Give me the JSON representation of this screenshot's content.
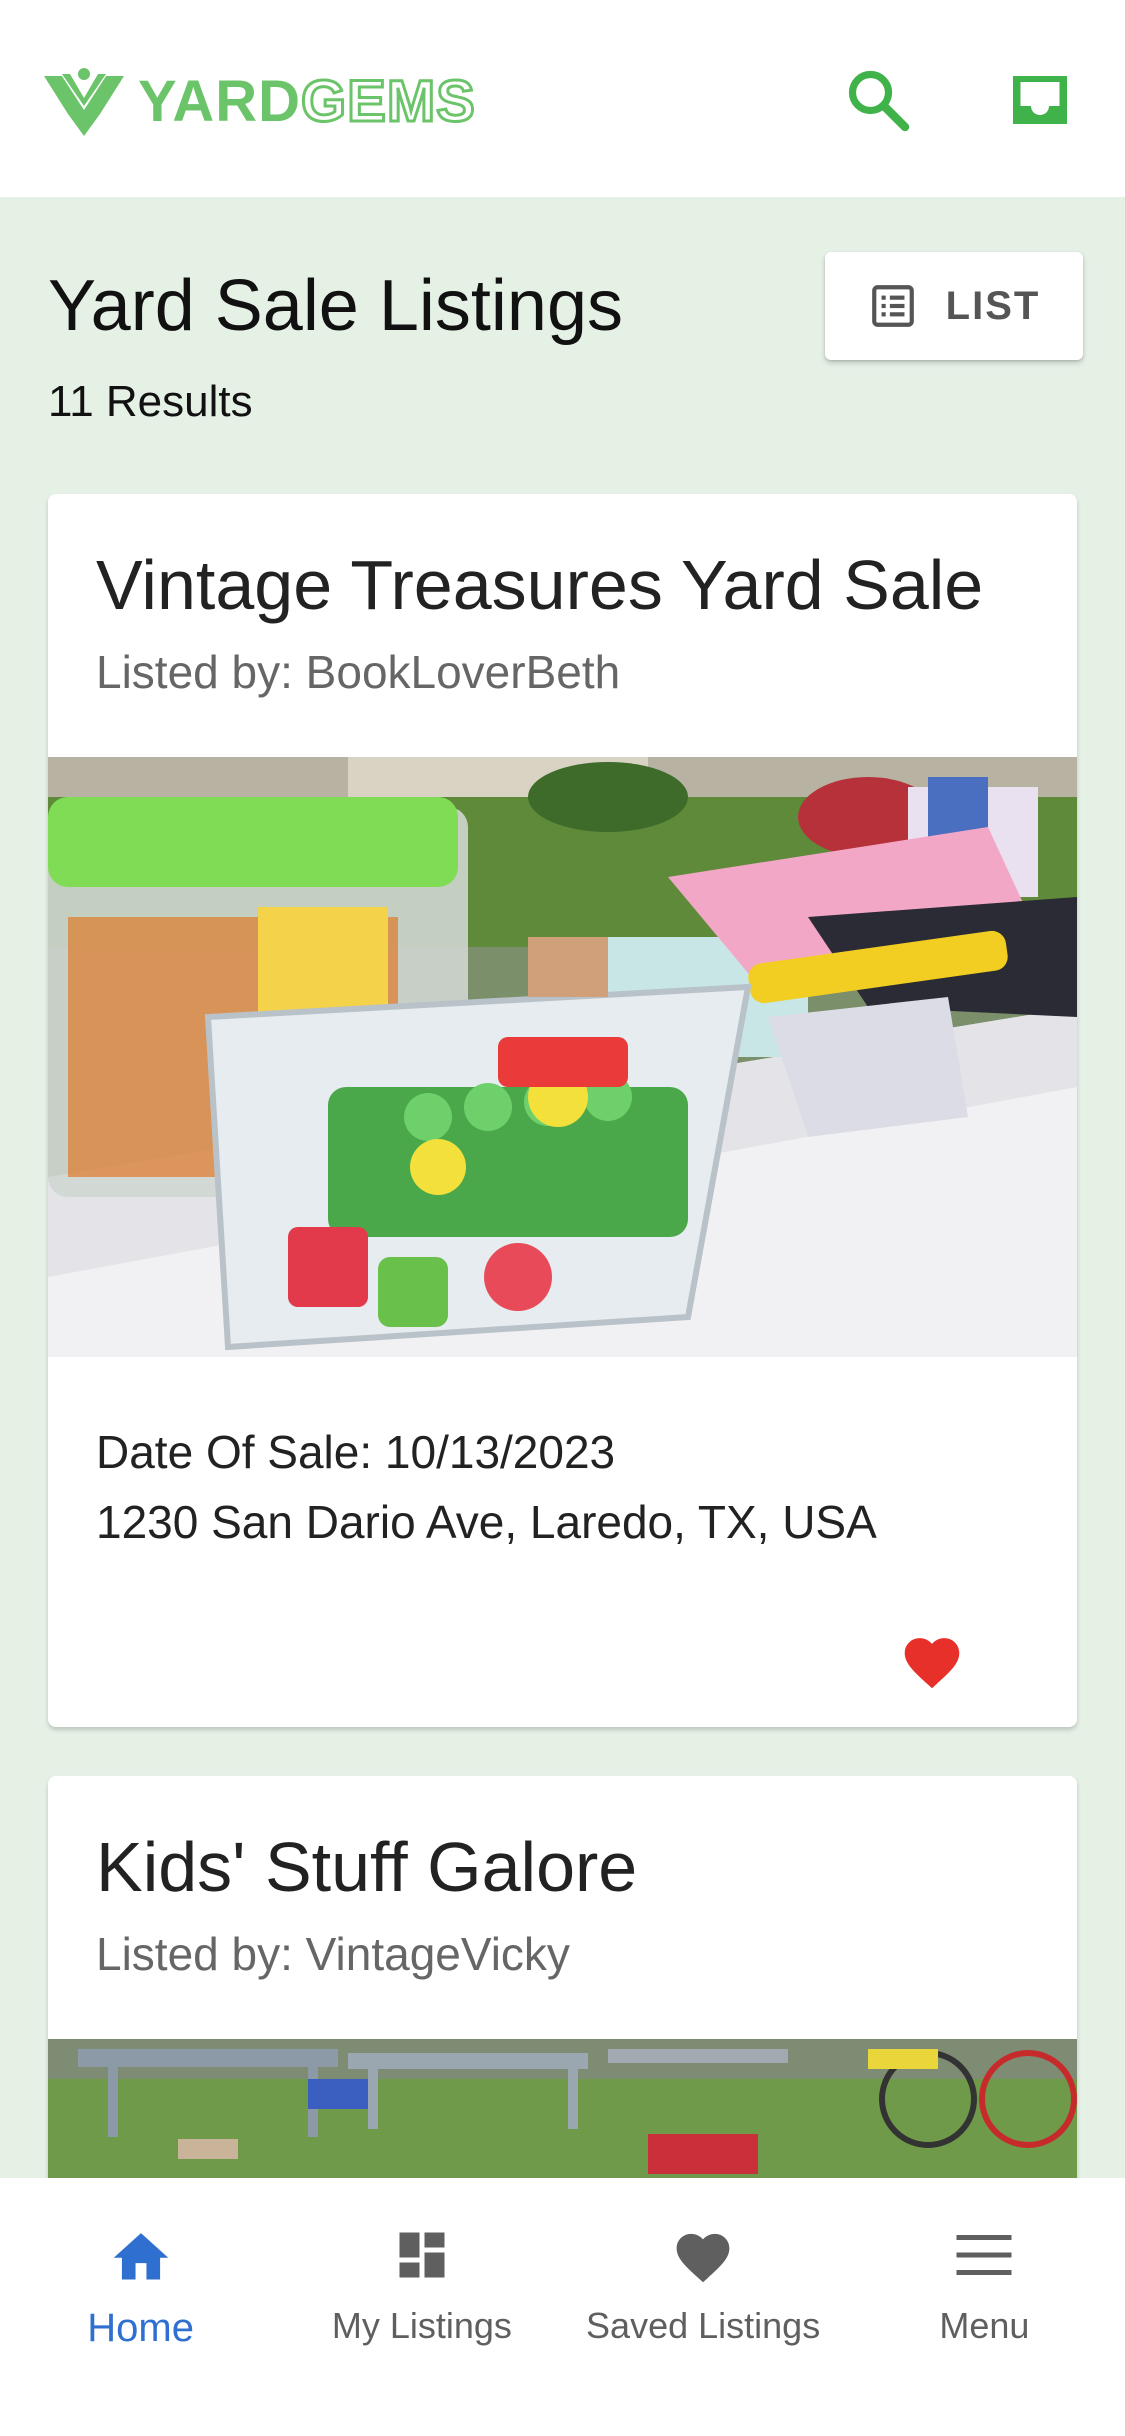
{
  "header": {
    "logo_word1": "YARD",
    "logo_word2": "GEMS",
    "brand_color": "#6cc46a",
    "icons": [
      "search-icon",
      "inbox-icon"
    ]
  },
  "page": {
    "title": "Yard Sale Listings",
    "results": "11 Results",
    "view_toggle_label": "LIST",
    "view_toggle_icon": "list-view-icon"
  },
  "listings": [
    {
      "title": "Vintage Treasures Yard Sale",
      "listed_by": "Listed by: BookLoverBeth",
      "date": "Date Of Sale: 10/13/2023",
      "address": "1230 San Dario Ave, Laredo, TX, USA",
      "saved": true,
      "photo": "photo of toys and plastic bins on a table"
    },
    {
      "title": "Kids' Stuff Galore",
      "listed_by": "Listed by: VintageVicky",
      "photo": "photo of tables and bikes on a lawn"
    }
  ],
  "bottom_nav": {
    "items": [
      {
        "label": "Home",
        "icon": "home-icon",
        "active": true
      },
      {
        "label": "My Listings",
        "icon": "dashboard-icon",
        "active": false
      },
      {
        "label": "Saved Listings",
        "icon": "heart-icon",
        "active": false
      },
      {
        "label": "Menu",
        "icon": "menu-icon",
        "active": false
      }
    ]
  },
  "colors": {
    "background": "#e6f1e6",
    "active_nav": "#2f6fd0",
    "heart": "#e8302a",
    "inactive_icon": "#5f5f5f"
  }
}
